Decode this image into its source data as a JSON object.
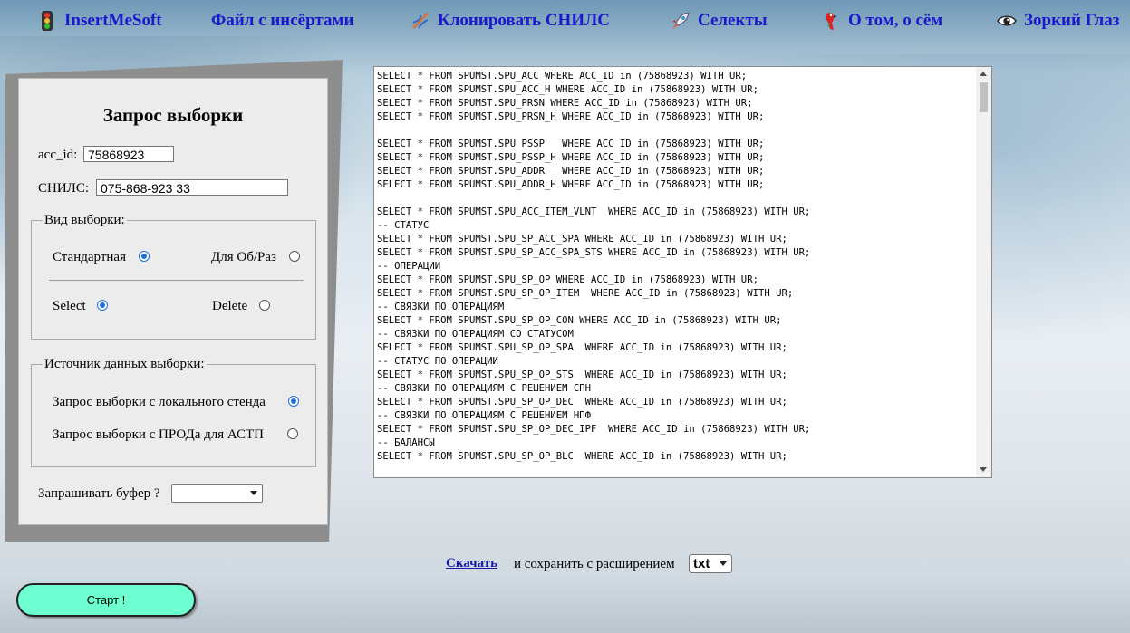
{
  "nav": {
    "items": [
      {
        "label": "InsertMeSoft",
        "icon": "traffic-light-icon"
      },
      {
        "label": "Файл с инсёртами",
        "icon": ""
      },
      {
        "label": "Клонировать СНИЛС",
        "icon": "dna-icon"
      },
      {
        "label": "Селекты",
        "icon": "rocket-icon"
      },
      {
        "label": "О том, о сём",
        "icon": "parrot-icon"
      },
      {
        "label": "Зоркий Глаз",
        "icon": "eye-icon"
      }
    ]
  },
  "form": {
    "title": "Запрос выборки",
    "acc_id_label": "acc_id:",
    "acc_id_value": "75868923",
    "snils_label": "СНИЛС:",
    "snils_value": "075-868-923 33",
    "view_group": {
      "legend": "Вид выборки:",
      "standard_label": "Стандартная",
      "standard_checked": true,
      "for_once_label": "Для Об/Раз",
      "for_once_checked": false,
      "select_label": "Select",
      "select_checked": true,
      "delete_label": "Delete",
      "delete_checked": false
    },
    "source_group": {
      "legend": "Источник данных выборки:",
      "local_label": "Запрос выборки с локального стенда",
      "local_checked": true,
      "prod_label": "Запрос выборки с ПРОДа для АСТП",
      "prod_checked": false
    },
    "buffer_label": "Запрашивать буфер ?",
    "buffer_value": ""
  },
  "sql_lines": [
    "SELECT * FROM SPUMST.SPU_ACC WHERE ACC_ID in (75868923) WITH UR;",
    "SELECT * FROM SPUMST.SPU_ACC_H WHERE ACC_ID in (75868923) WITH UR;",
    "SELECT * FROM SPUMST.SPU_PRSN WHERE ACC_ID in (75868923) WITH UR;",
    "SELECT * FROM SPUMST.SPU_PRSN_H WHERE ACC_ID in (75868923) WITH UR;",
    "",
    "SELECT * FROM SPUMST.SPU_PSSP   WHERE ACC_ID in (75868923) WITH UR;",
    "SELECT * FROM SPUMST.SPU_PSSP_H WHERE ACC_ID in (75868923) WITH UR;",
    "SELECT * FROM SPUMST.SPU_ADDR   WHERE ACC_ID in (75868923) WITH UR;",
    "SELECT * FROM SPUMST.SPU_ADDR_H WHERE ACC_ID in (75868923) WITH UR;",
    "",
    "SELECT * FROM SPUMST.SPU_ACC_ITEM_VLNT  WHERE ACC_ID in (75868923) WITH UR;",
    "-- СТАТУС",
    "SELECT * FROM SPUMST.SPU_SP_ACC_SPA WHERE ACC_ID in (75868923) WITH UR;",
    "SELECT * FROM SPUMST.SPU_SP_ACC_SPA_STS WHERE ACC_ID in (75868923) WITH UR;",
    "-- ОПЕРАЦИИ",
    "SELECT * FROM SPUMST.SPU_SP_OP WHERE ACC_ID in (75868923) WITH UR;",
    "SELECT * FROM SPUMST.SPU_SP_OP_ITEM  WHERE ACC_ID in (75868923) WITH UR;",
    "-- СВЯЗКИ ПО ОПЕРАЦИЯМ",
    "SELECT * FROM SPUMST.SPU_SP_OP_CON WHERE ACC_ID in (75868923) WITH UR;",
    "-- СВЯЗКИ ПО ОПЕРАЦИЯМ СО СТАТУСОМ",
    "SELECT * FROM SPUMST.SPU_SP_OP_SPA  WHERE ACC_ID in (75868923) WITH UR;",
    "-- СТАТУС ПО ОПЕРАЦИИ",
    "SELECT * FROM SPUMST.SPU_SP_OP_STS  WHERE ACC_ID in (75868923) WITH UR;",
    "-- СВЯЗКИ ПО ОПЕРАЦИЯМ С РЕШЕНИЕМ СПН",
    "SELECT * FROM SPUMST.SPU_SP_OP_DEC  WHERE ACC_ID in (75868923) WITH UR;",
    "-- СВЯЗКИ ПО ОПЕРАЦИЯМ С РЕШЕНИЕМ НПФ",
    "SELECT * FROM SPUMST.SPU_SP_OP_DEC_IPF  WHERE ACC_ID in (75868923) WITH UR;",
    "-- БАЛАНСЫ",
    "SELECT * FROM SPUMST.SPU_SP_OP_BLC  WHERE ACC_ID in (75868923) WITH UR;"
  ],
  "download": {
    "link_label": "Скачать",
    "text": "и сохранить с расширением",
    "ext_value": "txt"
  },
  "start_button": "Старт !"
}
